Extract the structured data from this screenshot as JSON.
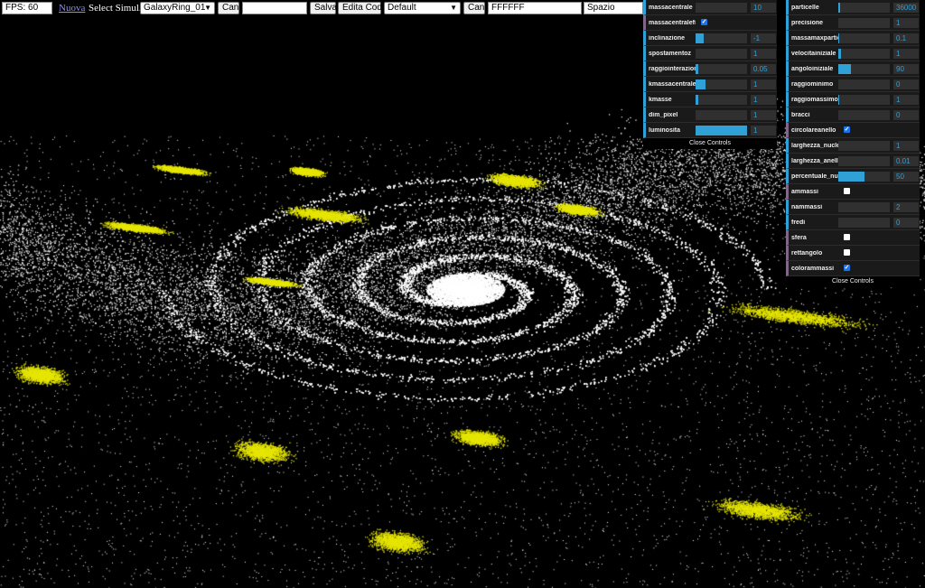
{
  "toolbar": {
    "fps": "FPS: 60",
    "nuova": "Nuova",
    "select_label": "Select Simul.:",
    "simulation": "GalaxyRing_01",
    "can1": "Can",
    "name_value": "",
    "salva": "Salva",
    "edita": "Edita Cod.",
    "preset": "Default",
    "can2": "Can",
    "color_value": "FFFFFF",
    "spazio": "Spazio"
  },
  "panel_left": {
    "close": "Close Controls",
    "rows": [
      {
        "label": "massacentrale",
        "type": "slider",
        "value": "10",
        "fill": 0.0
      },
      {
        "label": "massacentralefi...",
        "type": "bool",
        "checked": true
      },
      {
        "label": "inclinazione",
        "type": "slider",
        "value": "-1",
        "fill": 0.15
      },
      {
        "label": "spostamentoz",
        "type": "slider",
        "value": "1",
        "fill": 0.0
      },
      {
        "label": "raggiointerazione",
        "type": "slider",
        "value": "0.05",
        "fill": 0.05
      },
      {
        "label": "kmassacentrale",
        "type": "slider",
        "value": "1",
        "fill": 0.2
      },
      {
        "label": "kmasse",
        "type": "slider",
        "value": "1",
        "fill": 0.05
      },
      {
        "label": "dim_pixel",
        "type": "slider",
        "value": "1",
        "fill": 0.0
      },
      {
        "label": "luminosita",
        "type": "slider",
        "value": "1",
        "fill": 1.0
      }
    ]
  },
  "panel_right": {
    "close": "Close Controls",
    "rows": [
      {
        "label": "particelle",
        "type": "slider",
        "value": "36000",
        "fill": 0.04
      },
      {
        "label": "precisione",
        "type": "slider",
        "value": "1",
        "fill": 0.0
      },
      {
        "label": "massamaxparticl...",
        "type": "slider",
        "value": "0.1",
        "fill": 0.02
      },
      {
        "label": "velocitainiziale",
        "type": "slider",
        "value": "1",
        "fill": 0.06
      },
      {
        "label": "angoloiniziale",
        "type": "slider",
        "value": "90",
        "fill": 0.25
      },
      {
        "label": "raggiominimo",
        "type": "slider",
        "value": "0",
        "fill": 0.0
      },
      {
        "label": "raggiomassimo",
        "type": "slider",
        "value": "1",
        "fill": 0.02
      },
      {
        "label": "bracci",
        "type": "slider",
        "value": "0",
        "fill": 0.0
      },
      {
        "label": "circolareanello",
        "type": "bool",
        "checked": true
      },
      {
        "label": "larghezza_nucleo",
        "type": "slider",
        "value": "1",
        "fill": 0.0
      },
      {
        "label": "larghezza_anello",
        "type": "slider",
        "value": "0.01",
        "fill": 0.0
      },
      {
        "label": "percentuale_nuc...",
        "type": "slider",
        "value": "50",
        "fill": 0.5
      },
      {
        "label": "ammassi",
        "type": "bool",
        "checked": false
      },
      {
        "label": "nammassi",
        "type": "slider",
        "value": "2",
        "fill": 0.0
      },
      {
        "label": "fredi",
        "type": "slider",
        "value": "0",
        "fill": 0.0
      },
      {
        "label": "sfera",
        "type": "bool",
        "checked": false
      },
      {
        "label": "rettangolo",
        "type": "bool",
        "checked": false
      },
      {
        "label": "colorammassi",
        "type": "bool",
        "checked": true
      }
    ]
  },
  "colors": {
    "background": "#000000",
    "particle_white": "#ffffff",
    "particle_yellow": "#e6e600",
    "accent": "#2fa1d6"
  }
}
